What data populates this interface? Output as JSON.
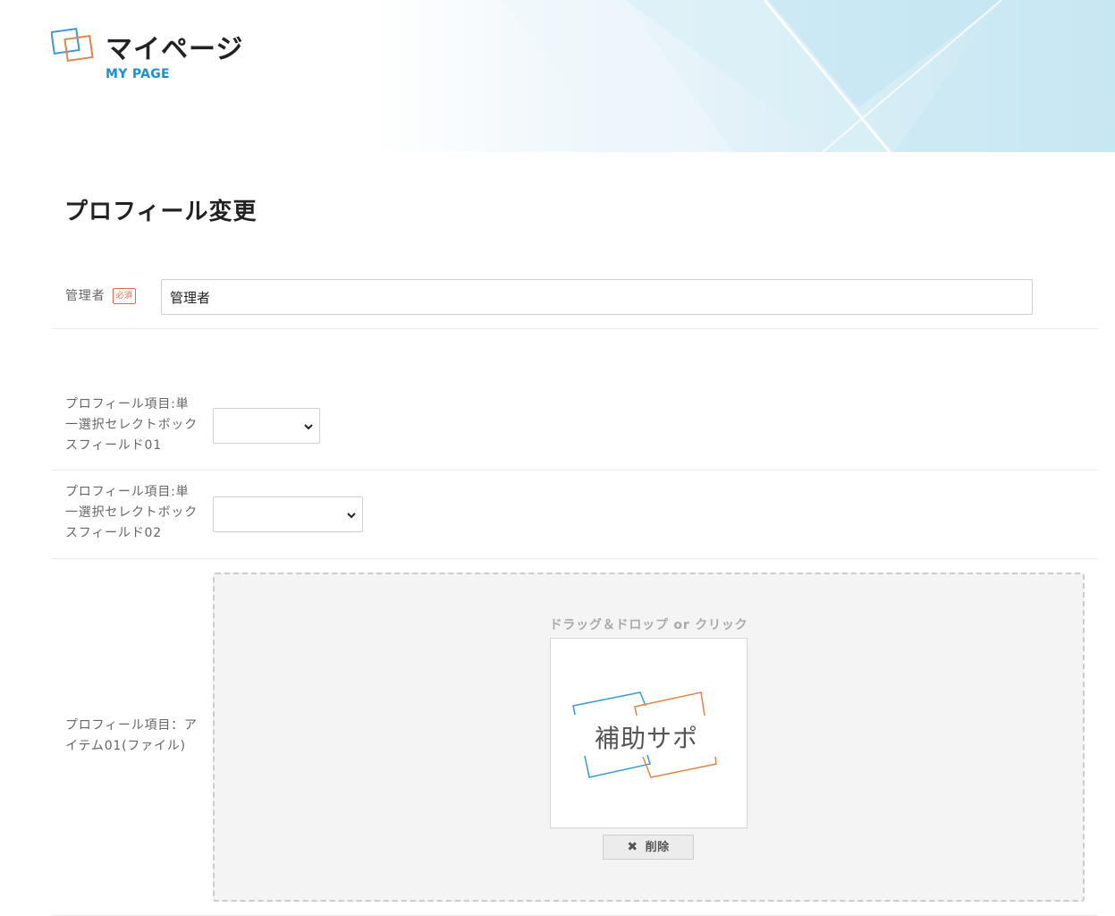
{
  "header": {
    "title": "マイページ",
    "subtitle": "MY PAGE"
  },
  "page": {
    "heading": "プロフィール変更"
  },
  "form": {
    "admin": {
      "label": "管理者",
      "required_badge": "必須",
      "value": "管理者"
    },
    "select01": {
      "label_line1": "プロフィール項目:単",
      "label_line2": "一選択セレクトボック",
      "label_line3": "スフィールド01",
      "value": ""
    },
    "select02": {
      "label_line1": "プロフィール項目:単",
      "label_line2": "一選択セレクトボック",
      "label_line3": "スフィールド02",
      "value": ""
    },
    "file01": {
      "label_line1": "プロフィール項目：ア",
      "label_line2": "イテム01(ファイル)",
      "dropzone_text": "ドラッグ＆ドロップ or クリック",
      "preview_text": "補助サポ",
      "delete_label": "削除"
    }
  },
  "colors": {
    "accent": "#1a8fd8",
    "logo_blue": "#3a9ad0",
    "logo_orange": "#e0864a",
    "required": "#e06a54"
  }
}
